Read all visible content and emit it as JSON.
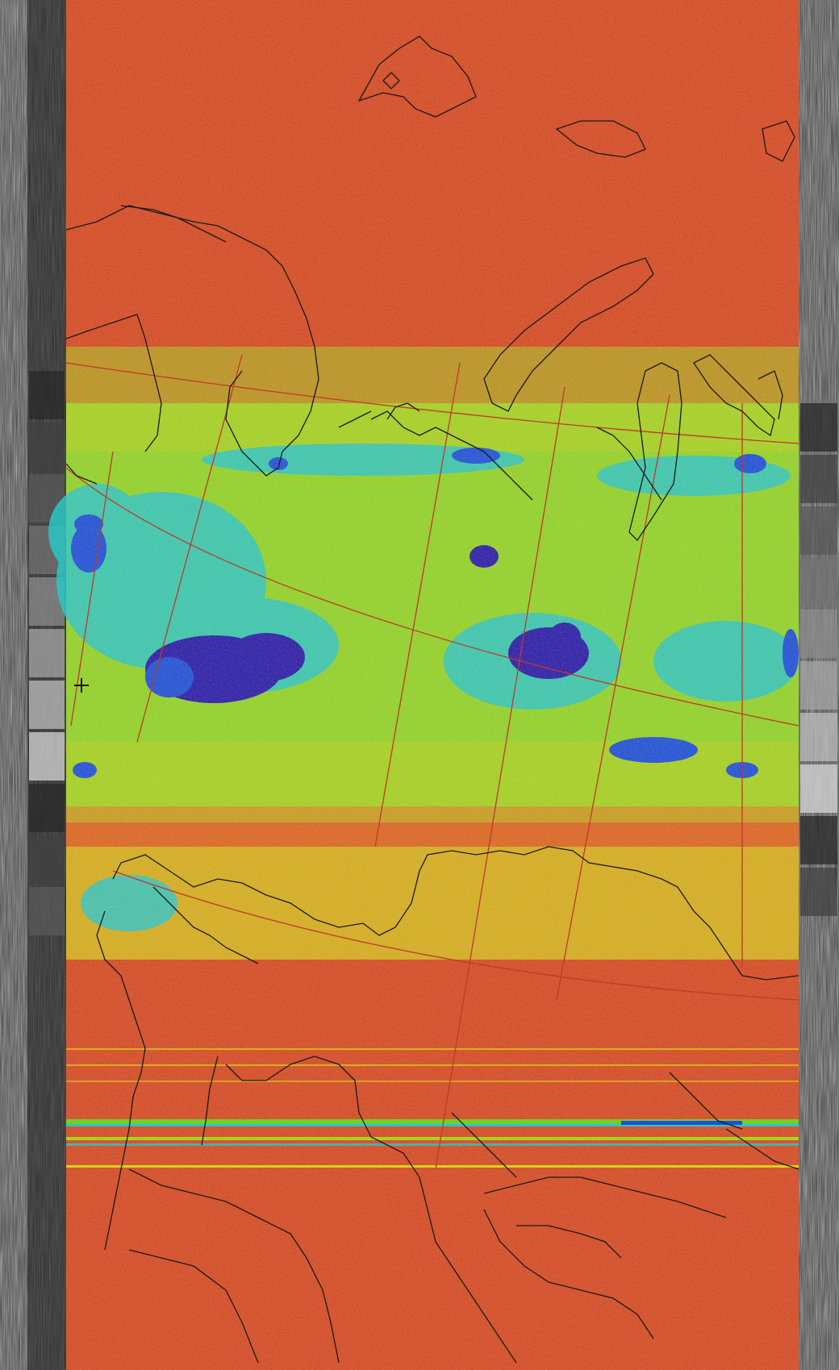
{
  "image": {
    "kind": "weather satellite image, false-colour thermal rendering",
    "palette": {
      "warm": "#d9481e",
      "warm_alt": "#e25a1c",
      "orange": "#f08a1a",
      "yellow": "#d8d21a",
      "yellow_green": "#a8d41e",
      "green": "#6fd02a",
      "cyan": "#2bc7c7",
      "blue": "#1f4fd8",
      "deep_blue": "#2a1aa8",
      "coastline": "#1a1a1a",
      "grid_line": "#c0392b",
      "telemetry_light": "#d8d8d8",
      "telemetry_dark": "#2a2a2a"
    },
    "icons": {
      "center_marker": "crosshair-icon"
    }
  }
}
